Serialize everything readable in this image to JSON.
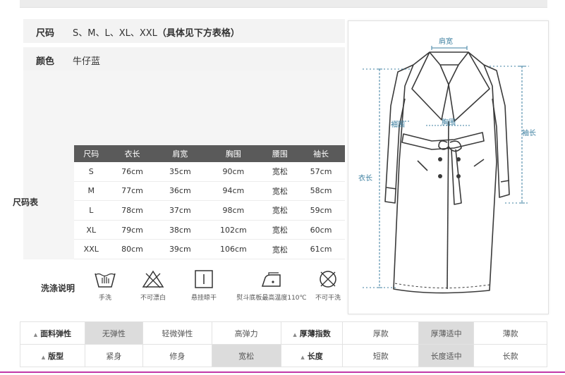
{
  "info": {
    "size_label": "尺码",
    "size_value": "S、M、L、XL、XXL",
    "size_note": "（具体见下方表格）",
    "color_label": "颜色",
    "color_value": "牛仔蓝"
  },
  "size_chart": {
    "label": "尺码表",
    "headers": [
      "尺码",
      "衣长",
      "肩宽",
      "胸围",
      "腰围",
      "袖长"
    ],
    "rows": [
      [
        "S",
        "76cm",
        "35cm",
        "90cm",
        "宽松",
        "57cm"
      ],
      [
        "M",
        "77cm",
        "36cm",
        "94cm",
        "宽松",
        "58cm"
      ],
      [
        "L",
        "78cm",
        "37cm",
        "98cm",
        "宽松",
        "59cm"
      ],
      [
        "XL",
        "79cm",
        "38cm",
        "102cm",
        "宽松",
        "60cm"
      ],
      [
        "XXL",
        "80cm",
        "39cm",
        "106cm",
        "宽松",
        "61cm"
      ]
    ]
  },
  "care": {
    "label": "洗涤说明",
    "items": [
      {
        "icon": "hand-wash-icon",
        "text": "手洗"
      },
      {
        "icon": "no-bleach-icon",
        "text": "不可漂白"
      },
      {
        "icon": "hang-dry-icon",
        "text": "悬挂晾干"
      },
      {
        "icon": "iron-icon",
        "text": "熨斗底板最高温度110℃"
      },
      {
        "icon": "no-dry-clean-icon",
        "text": "不可干洗"
      }
    ]
  },
  "diagram": {
    "shoulder": "肩宽",
    "sleeve_width": "袖围",
    "chest": "胸围",
    "sleeve_length": "袖长",
    "length": "衣长"
  },
  "attributes": {
    "row1": {
      "fabric_label": "面料弹性",
      "fabric_options": [
        "无弹性",
        "轻微弹性",
        "高弹力"
      ],
      "fabric_selected": 0,
      "thickness_label": "厚薄指数",
      "thickness_options": [
        "厚款",
        "厚薄适中",
        "薄款"
      ],
      "thickness_selected": 1
    },
    "row2": {
      "fit_label": "版型",
      "fit_options": [
        "紧身",
        "修身",
        "宽松"
      ],
      "fit_selected": 2,
      "length_label": "长度",
      "length_options": [
        "短款",
        "长度适中",
        "长款"
      ],
      "length_selected": 1
    }
  },
  "colors": {
    "header_bg": "#5a5a5a",
    "selected_bg": "#dcdcdc",
    "accent_bar": "#c238a8",
    "measure_line": "#3c7fa0"
  }
}
